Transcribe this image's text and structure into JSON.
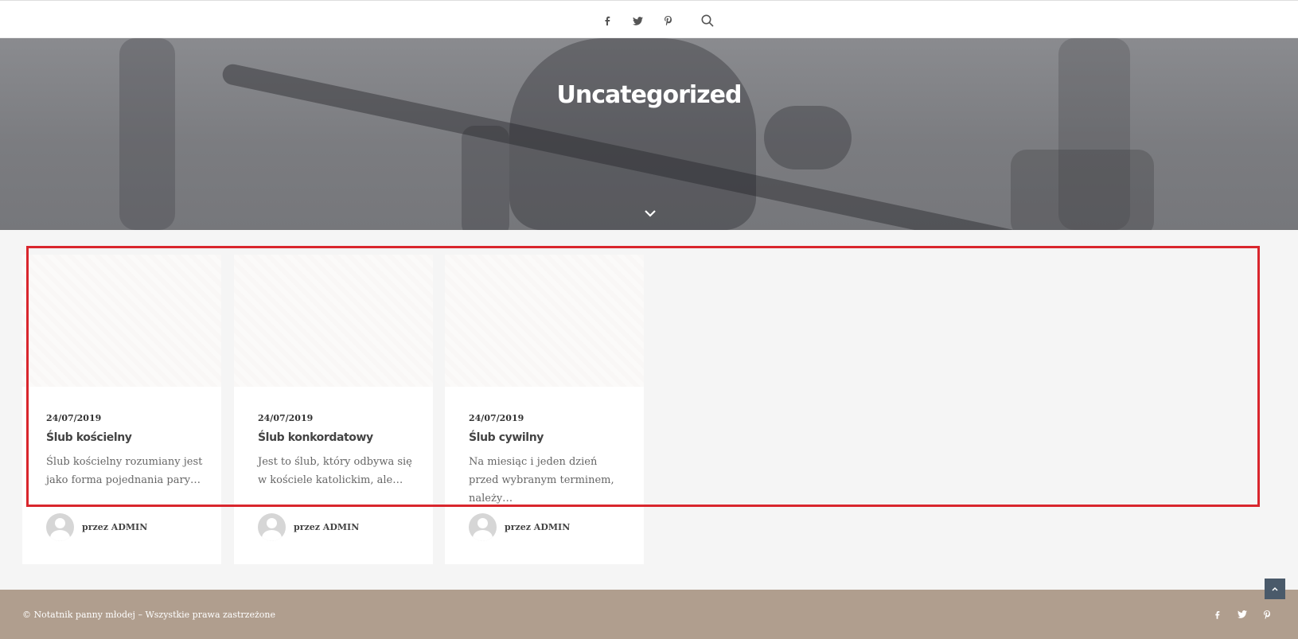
{
  "header": {
    "icons": [
      "facebook-icon",
      "twitter-icon",
      "pinterest-icon",
      "search-icon"
    ]
  },
  "hero": {
    "title": "Uncategorized"
  },
  "posts": [
    {
      "date": "24/07/2019",
      "title": "Ślub kościelny",
      "excerpt": "Ślub kościelny rozumiany jest jako forma pojednania pary…",
      "author": "przez ADMIN"
    },
    {
      "date": "24/07/2019",
      "title": "Ślub konkordatowy",
      "excerpt": "Jest to ślub, który odbywa się w kościele katolickim, ale…",
      "author": "przez ADMIN"
    },
    {
      "date": "24/07/2019",
      "title": "Ślub cywilny",
      "excerpt": "Na miesiąc i jeden dzień przed wybranym terminem, należy…",
      "author": "przez ADMIN"
    }
  ],
  "footer": {
    "copyright": "© Notatnik panny młodej – Wszystkie prawa zastrzeżone"
  },
  "colors": {
    "highlight": "#d9262d",
    "footer_bg": "#b09e8e",
    "back_to_top": "#4a5a6a"
  }
}
